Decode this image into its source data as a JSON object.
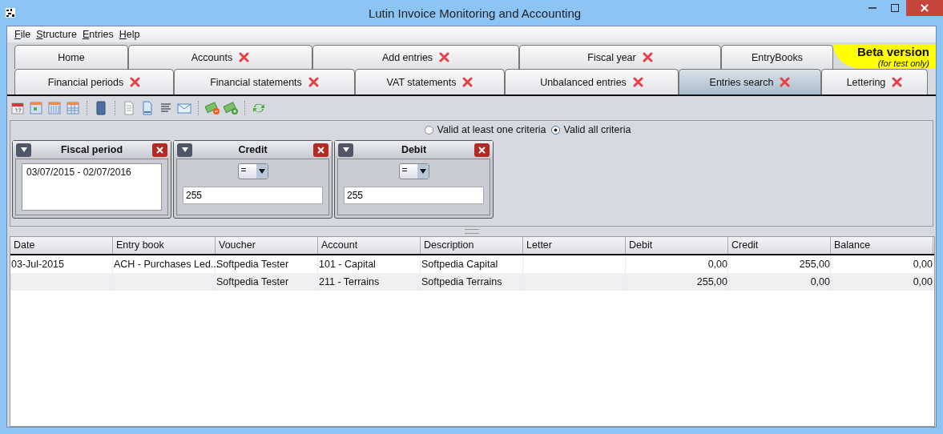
{
  "window": {
    "title": "Lutin Invoice Monitoring and Accounting"
  },
  "menu": [
    "File",
    "Structure",
    "Entries",
    "Help"
  ],
  "tab_rows": [
    [
      {
        "label": "Home",
        "closable": false,
        "selected": false
      },
      {
        "label": "Accounts",
        "closable": true,
        "selected": false
      },
      {
        "label": "Add entries",
        "closable": true,
        "selected": false
      },
      {
        "label": "Fiscal year",
        "closable": true,
        "selected": false
      },
      {
        "label": "EntryBooks",
        "closable": false,
        "selected": false
      }
    ],
    [
      {
        "label": "Financial periods",
        "closable": true,
        "selected": false
      },
      {
        "label": "Financial statements",
        "closable": true,
        "selected": false
      },
      {
        "label": "VAT statements",
        "closable": true,
        "selected": false
      },
      {
        "label": "Unbalanced entries",
        "closable": true,
        "selected": false
      },
      {
        "label": "Entries search",
        "closable": true,
        "selected": true
      },
      {
        "label": "Lettering",
        "closable": true,
        "selected": false
      }
    ]
  ],
  "beta_badge": {
    "title": "Beta version",
    "subtitle": "(for test only)"
  },
  "match_mode": [
    {
      "label": "Valid at least one criteria",
      "selected": false
    },
    {
      "label": "Valid all criteria",
      "selected": true
    }
  ],
  "criteria": [
    {
      "kind": "list",
      "title": "Fiscal period",
      "items": [
        "03/07/2015 - 02/07/2016"
      ]
    },
    {
      "kind": "comparison",
      "title": "Credit",
      "operator": "=",
      "value": "255"
    },
    {
      "kind": "comparison",
      "title": "Debit",
      "operator": "=",
      "value": "255"
    }
  ],
  "table": {
    "columns": [
      "Date",
      "Entry book",
      "Voucher",
      "Account",
      "Description",
      "Letter",
      "Debit",
      "Credit",
      "Balance"
    ],
    "rows": [
      [
        "03-Jul-2015",
        "ACH - Purchases Led...",
        "Softpedia Tester",
        "101 - Capital",
        "Softpedia Capital",
        "",
        "0,00",
        "255,00",
        "0,00"
      ],
      [
        "",
        "",
        "Softpedia Tester",
        "211 - Terrains",
        "Softpedia Terrains",
        "",
        "255,00",
        "0,00",
        "0,00"
      ]
    ]
  }
}
